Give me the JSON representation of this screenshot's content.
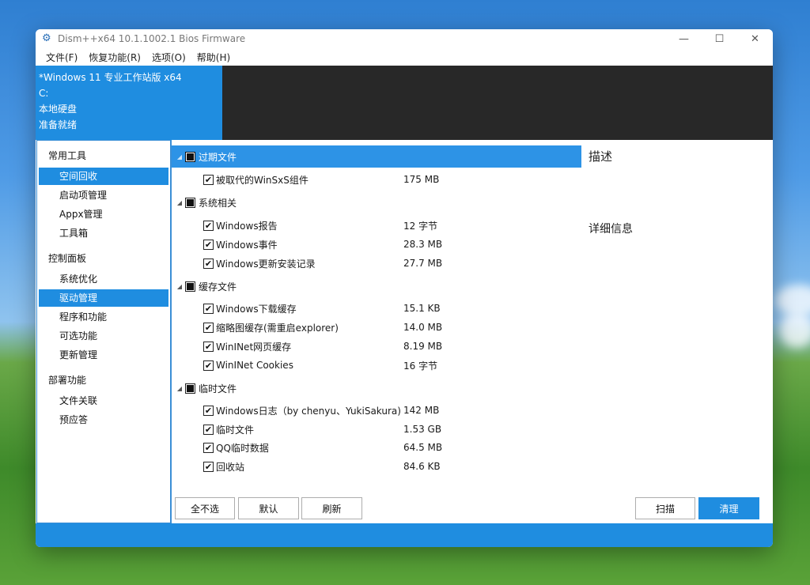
{
  "window": {
    "title": "Dism++x64 10.1.1002.1 Bios Firmware"
  },
  "titlebar": {
    "minimize_icon": "minimize-icon",
    "maximize_icon": "maximize-icon",
    "close_icon": "close-icon"
  },
  "menu": [
    "文件(F)",
    "恢复功能(R)",
    "选项(O)",
    "帮助(H)"
  ],
  "banner": {
    "os": "*Windows 11 专业工作站版 x64",
    "drive": "C:",
    "disk": "本地硬盘",
    "status": "准备就绪"
  },
  "sidebar": {
    "sections": [
      {
        "header": "常用工具",
        "items": [
          "空间回收",
          "启动项管理",
          "Appx管理",
          "工具箱"
        ]
      },
      {
        "header": "控制面板",
        "items": [
          "系统优化",
          "驱动管理",
          "程序和功能",
          "可选功能",
          "更新管理"
        ]
      },
      {
        "header": "部署功能",
        "items": [
          "文件关联",
          "预应答"
        ]
      }
    ],
    "active_items": [
      "空间回收",
      "驱动管理"
    ]
  },
  "tree": [
    {
      "name": "过期文件",
      "items": [
        {
          "label": "被取代的WinSxS组件",
          "size": "175 MB"
        }
      ]
    },
    {
      "name": "系统相关",
      "items": [
        {
          "label": "Windows报告",
          "size": "12 字节"
        },
        {
          "label": "Windows事件",
          "size": "28.3 MB"
        },
        {
          "label": "Windows更新安装记录",
          "size": "27.7 MB"
        }
      ]
    },
    {
      "name": "缓存文件",
      "items": [
        {
          "label": "Windows下载缓存",
          "size": "15.1 KB"
        },
        {
          "label": "缩略图缓存(需重启explorer)",
          "size": "14.0 MB"
        },
        {
          "label": "WinINet网页缓存",
          "size": "8.19 MB"
        },
        {
          "label": "WinINet Cookies",
          "size": "16 字节"
        }
      ]
    },
    {
      "name": "临时文件",
      "items": [
        {
          "label": "Windows日志（by chenyu、YukiSakura)",
          "size": "142 MB"
        },
        {
          "label": "临时文件",
          "size": "1.53 GB"
        },
        {
          "label": "QQ临时数据",
          "size": "64.5 MB"
        },
        {
          "label": "回收站",
          "size": "84.6 KB"
        }
      ]
    }
  ],
  "panel": {
    "description_title": "描述",
    "details_title": "详细信息"
  },
  "buttons": {
    "deselect_all": "全不选",
    "default": "默认",
    "refresh": "刷新",
    "scan": "扫描",
    "clean": "清理"
  },
  "colors": {
    "accent": "#1f8de0",
    "banner_dark": "#282828"
  }
}
